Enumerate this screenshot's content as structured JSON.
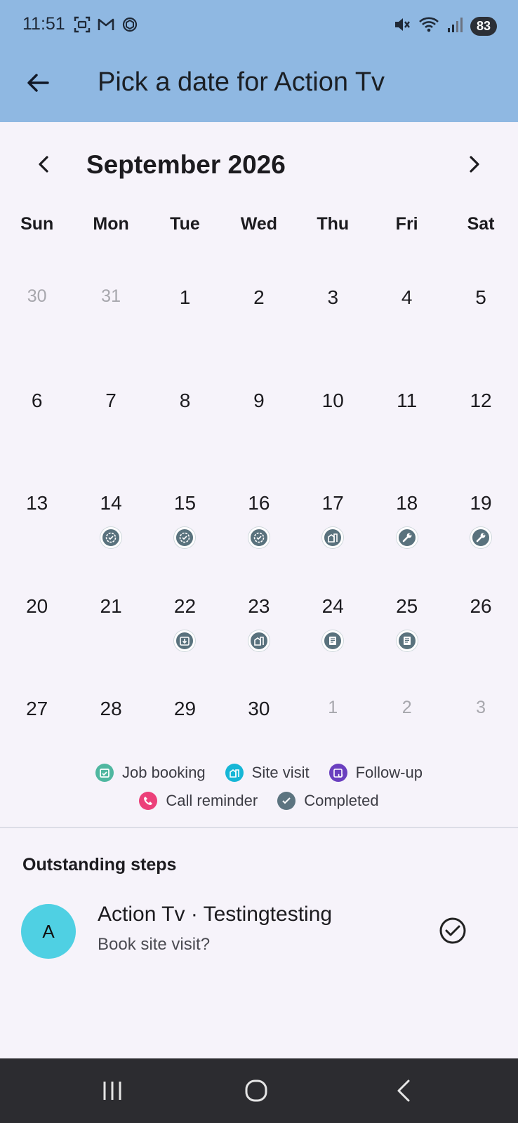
{
  "status_bar": {
    "time": "11:51",
    "battery": "83",
    "left_icons": [
      "screenshot-icon",
      "gmail-icon",
      "openai-icon"
    ],
    "right_icons": [
      "mute-icon",
      "wifi-icon",
      "signal-icon"
    ]
  },
  "app_bar": {
    "title": "Pick a date for Action Tv",
    "back_icon": "arrow-left-icon"
  },
  "calendar": {
    "month_label": "September 2026",
    "weekdays": [
      "Sun",
      "Mon",
      "Tue",
      "Wed",
      "Thu",
      "Fri",
      "Sat"
    ],
    "weeks": [
      [
        {
          "day": "30",
          "muted": true
        },
        {
          "day": "31",
          "muted": true
        },
        {
          "day": "1"
        },
        {
          "day": "2"
        },
        {
          "day": "3"
        },
        {
          "day": "4"
        },
        {
          "day": "5"
        }
      ],
      [
        {
          "day": "6"
        },
        {
          "day": "7"
        },
        {
          "day": "8"
        },
        {
          "day": "9"
        },
        {
          "day": "10"
        },
        {
          "day": "11"
        },
        {
          "day": "12"
        }
      ],
      [
        {
          "day": "13"
        },
        {
          "day": "14",
          "icon": "completed-icon"
        },
        {
          "day": "15",
          "icon": "completed-icon"
        },
        {
          "day": "16",
          "icon": "completed-icon"
        },
        {
          "day": "17",
          "icon": "site-visit-icon"
        },
        {
          "day": "18",
          "icon": "wrench-icon"
        },
        {
          "day": "19",
          "icon": "wrench-icon"
        }
      ],
      [
        {
          "day": "20"
        },
        {
          "day": "21"
        },
        {
          "day": "22",
          "icon": "download-box-icon"
        },
        {
          "day": "23",
          "icon": "site-visit-icon"
        },
        {
          "day": "24",
          "icon": "document-icon"
        },
        {
          "day": "25",
          "icon": "document-icon"
        },
        {
          "day": "26"
        }
      ],
      [
        {
          "day": "27"
        },
        {
          "day": "28"
        },
        {
          "day": "29"
        },
        {
          "day": "30"
        },
        {
          "day": "1",
          "muted": true
        },
        {
          "day": "2",
          "muted": true
        },
        {
          "day": "3",
          "muted": true
        }
      ]
    ]
  },
  "legend": {
    "row1": [
      {
        "label": "Job booking",
        "color": "#4fb7a0",
        "icon": "calendar-check-icon"
      },
      {
        "label": "Site visit",
        "color": "#16b6d6",
        "icon": "site-visit-icon"
      },
      {
        "label": "Follow-up",
        "color": "#6a3fbf",
        "icon": "follow-up-icon"
      }
    ],
    "row2": [
      {
        "label": "Call reminder",
        "color": "#ec407a",
        "icon": "phone-icon"
      },
      {
        "label": "Completed",
        "color": "#5c7480",
        "icon": "check-icon"
      }
    ]
  },
  "outstanding": {
    "title": "Outstanding steps",
    "items": [
      {
        "avatar": "A",
        "title": "Action Tv · Testingtesting",
        "subtitle": "Book site visit?"
      }
    ]
  },
  "colors": {
    "app_bar": "#8fb8e2",
    "background": "#f6f3fa",
    "event_icon": "#59727d",
    "avatar": "#4fd0e3"
  }
}
